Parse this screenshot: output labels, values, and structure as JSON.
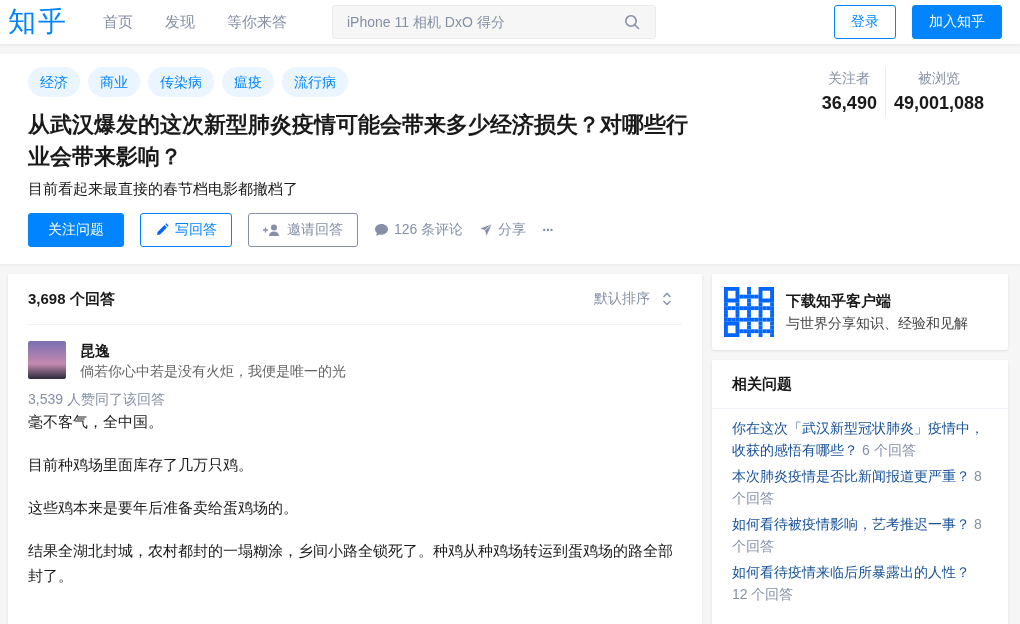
{
  "header": {
    "logo": "知乎",
    "nav": [
      {
        "label": "首页",
        "selected": false
      },
      {
        "label": "发现",
        "selected": false
      },
      {
        "label": "等你来答",
        "selected": false
      }
    ],
    "search": {
      "placeholder": "iPhone 11 相机 DxO 得分"
    },
    "login": "登录",
    "join": "加入知乎"
  },
  "question": {
    "topics": [
      "经济",
      "商业",
      "传染病",
      "瘟疫",
      "流行病"
    ],
    "title": "从武汉爆发的这次新型肺炎疫情可能会带来多少经济损失？对哪些行业会带来影响？",
    "detail": "目前看起来最直接的春节档电影都撤档了",
    "stats": [
      {
        "label": "关注者",
        "value": "36,490"
      },
      {
        "label": "被浏览",
        "value": "49,001,088"
      }
    ],
    "buttons": [
      {
        "kind": "primary",
        "label": "关注问题"
      },
      {
        "kind": "write",
        "label": "写回答"
      },
      {
        "kind": "invite",
        "label": "邀请回答"
      }
    ],
    "actions": [
      {
        "kind": "comment",
        "label": "126 条评论"
      },
      {
        "kind": "share",
        "label": "分享"
      },
      {
        "kind": "more",
        "label": "···"
      }
    ]
  },
  "answers": {
    "count": "3,698 个回答",
    "sort": "默认排序",
    "author": {
      "name": "昆逸",
      "bio": "倘若你心中若是没有火炬，我便是唯一的光"
    },
    "votes": "3,539 人赞同了该回答",
    "paragraphs": [
      "毫不客气，全中国。",
      "目前种鸡场里面库存了几万只鸡。",
      "这些鸡本来是要年后准备卖给蛋鸡场的。",
      "结果全湖北封城，农村都封的一塌糊涂，乡间小路全锁死了。种鸡从种鸡场转运到蛋鸡场的路全部封了。"
    ]
  },
  "sidebar": {
    "download": {
      "title": "下载知乎客户端",
      "subtitle": "与世界分享知识、经验和见解"
    },
    "related": {
      "title": "相关问题",
      "items": [
        {
          "question": "你在这次「武汉新型冠状肺炎」疫情中，收获的感悟有哪些？",
          "count": "6 个回答"
        },
        {
          "question": "本次肺炎疫情是否比新闻报道更严重？",
          "count": "8 个回答"
        },
        {
          "question": "如何看待被疫情影响，艺考推迟一事？",
          "count": "8 个回答"
        },
        {
          "question": "如何看待疫情来临后所暴露出的人性？",
          "count": "12 个回答"
        }
      ]
    }
  }
}
